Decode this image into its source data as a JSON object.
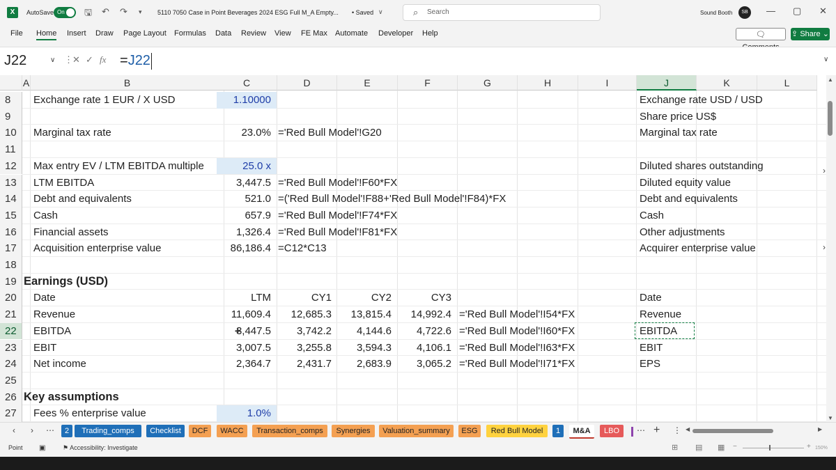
{
  "titlebar": {
    "autosave_label": "AutoSave",
    "autosave_state": "On",
    "doc_title": "5110 7050 Case in Point Beverages 2024 ESG Full M_A Empty...",
    "saved_status": "• Saved",
    "search_placeholder": "Search",
    "user_name": "Sound Booth",
    "avatar_initials": "SB"
  },
  "menu": [
    "File",
    "Home",
    "Insert",
    "Draw",
    "Page Layout",
    "Formulas",
    "Data",
    "Review",
    "View",
    "FE Max",
    "Automate",
    "Developer",
    "Help"
  ],
  "menu_active": "Home",
  "actions": {
    "comments": "Comments",
    "share": "Share"
  },
  "formula_bar": {
    "name_box": "J22",
    "fx": "fx",
    "formula_prefix": "=",
    "formula_ref": "J22"
  },
  "columns": [
    "A",
    "B",
    "C",
    "D",
    "E",
    "F",
    "G",
    "H",
    "I",
    "J",
    "K",
    "L"
  ],
  "selected_column": "J",
  "rows": [
    {
      "num": "8",
      "B": "Exchange rate 1 EUR / X USD",
      "C": "1.10000",
      "J": "Exchange rate USD / USD"
    },
    {
      "num": "9",
      "J": "Share price US$"
    },
    {
      "num": "10",
      "B": "Marginal tax rate",
      "C": "23.0%",
      "D": "='Red Bull Model'!G20",
      "J": "Marginal tax rate"
    },
    {
      "num": "11"
    },
    {
      "num": "12",
      "B": "Max entry EV / LTM EBITDA multiple",
      "C": "25.0 x",
      "J": "Diluted shares outstanding"
    },
    {
      "num": "13",
      "B": "LTM EBITDA",
      "C": "3,447.5",
      "D": "='Red Bull Model'!F60*FX",
      "J": "Diluted equity value"
    },
    {
      "num": "14",
      "B": "Debt and equivalents",
      "C": "521.0",
      "D": "=('Red Bull Model'!F88+'Red Bull Model'!F84)*FX",
      "J": "Debt and equivalents"
    },
    {
      "num": "15",
      "B": "Cash",
      "C": "657.9",
      "D": "='Red Bull Model'!F74*FX",
      "J": "Cash"
    },
    {
      "num": "16",
      "B": "Financial assets",
      "C": "1,326.4",
      "D": "='Red Bull Model'!F81*FX",
      "J": "Other adjustments"
    },
    {
      "num": "17",
      "B": "Acquisition enterprise value",
      "C": "86,186.4",
      "D": "=C12*C13",
      "J": "Acquirer enterprise value"
    },
    {
      "num": "18"
    },
    {
      "num": "19",
      "A": "Earnings (USD)"
    },
    {
      "num": "20",
      "B": "Date",
      "C": "LTM",
      "D": "CY1",
      "E": "CY2",
      "F": "CY3",
      "J": "Date"
    },
    {
      "num": "21",
      "B": "Revenue",
      "C": "11,609.4",
      "D": "12,685.3",
      "E": "13,815.4",
      "F": "14,992.4",
      "G": "='Red Bull Model'!I54*FX",
      "J": "Revenue"
    },
    {
      "num": "22",
      "B": "EBITDA",
      "C": "3,447.5",
      "D": "3,742.2",
      "E": "4,144.6",
      "F": "4,722.6",
      "G": "='Red Bull Model'!I60*FX",
      "J": "EBITDA"
    },
    {
      "num": "23",
      "B": "EBIT",
      "C": "3,007.5",
      "D": "3,255.8",
      "E": "3,594.3",
      "F": "4,106.1",
      "G": "='Red Bull Model'!I63*FX",
      "J": "EBIT"
    },
    {
      "num": "24",
      "B": "Net income",
      "C": "2,364.7",
      "D": "2,431.7",
      "E": "2,683.9",
      "F": "3,065.2",
      "G": "='Red Bull Model'!I71*FX",
      "J": "EPS"
    },
    {
      "num": "25"
    },
    {
      "num": "26",
      "A": "Key assumptions"
    },
    {
      "num": "27",
      "B": "Fees % enterprise value",
      "C": "1.0%"
    }
  ],
  "sheet_tabs": [
    {
      "label": "2",
      "style": "blue"
    },
    {
      "label": "Trading_comps",
      "style": "blue"
    },
    {
      "label": "Checklist",
      "style": "blue"
    },
    {
      "label": "DCF",
      "style": "orange"
    },
    {
      "label": "WACC",
      "style": "orange"
    },
    {
      "label": "Transaction_comps",
      "style": "orange"
    },
    {
      "label": "Synergies",
      "style": "orange"
    },
    {
      "label": "Valuation_summary",
      "style": "orange"
    },
    {
      "label": "ESG",
      "style": "orange"
    },
    {
      "label": "Red Bull Model",
      "style": "yellow"
    },
    {
      "label": "1",
      "style": "blue"
    },
    {
      "label": "M&A",
      "style": "active"
    },
    {
      "label": "LBO",
      "style": "pink"
    }
  ],
  "statusbar": {
    "mode": "Point",
    "accessibility": "Accessibility: Investigate",
    "zoom": "150%"
  },
  "colors": {
    "brand": "#107c41",
    "blue_tab": "#1f6fb8",
    "orange_tab": "#f4a052",
    "yellow_tab": "#ffd23f",
    "input_blue": "#1f3ea8"
  }
}
